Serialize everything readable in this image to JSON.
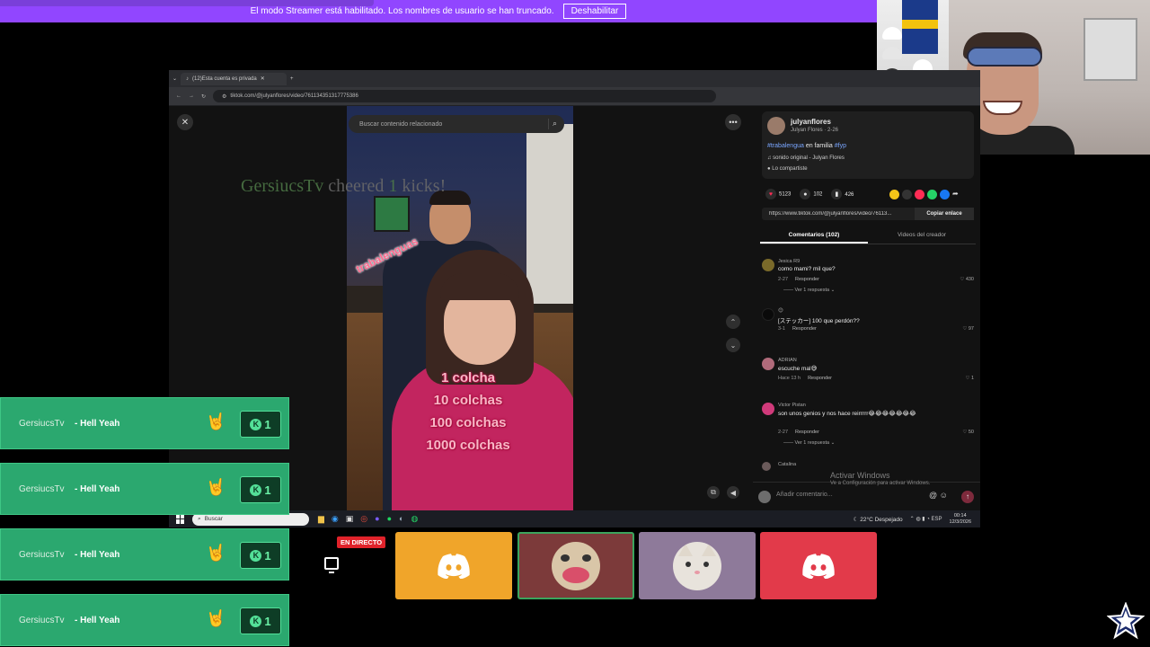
{
  "streamer_banner": {
    "message": "El modo Streamer está habilitado. Los nombres de usuario se han truncado.",
    "button_label": "Deshabilitar"
  },
  "browser": {
    "tab_title": "(12)Esta cuenta es privada",
    "url": "tiktok.com/@julyanflores/video/761134351317775386"
  },
  "video": {
    "search_placeholder": "Buscar contenido relacionado",
    "cheer": {
      "user": "GersiucsTv",
      "mid": "cheered",
      "count": "1",
      "end": "kicks!"
    },
    "tag": "trabalenguas",
    "overlay_lines": [
      "1 colcha",
      "10 colchas",
      "100 colchas",
      "1000 colchas"
    ]
  },
  "panel": {
    "author_name": "julyanflores",
    "author_sub": "Julyan Flores · 2-26",
    "caption_hash1": "#trabalengua",
    "caption_mid": " en familia ",
    "caption_hash2": "#fyp",
    "music": "sonido original - Julyan Flores",
    "shared": "Lo compartiste",
    "likes": "5123",
    "comments_count": "102",
    "saves": "426",
    "link": "https://www.tiktok.com/@julyanflores/video/76113...",
    "copy_label": "Copiar enlace",
    "tab_comments": "Comentarios (102)",
    "tab_creator": "Videos del creador",
    "comments": [
      {
        "user": "Jesica R9",
        "text": "como mami? mil que?",
        "date": "2-27",
        "reply": "Responder",
        "likes": "430",
        "replies": "—— Ver 1 respuesta ⌄",
        "color": "#7a6a2a"
      },
      {
        "user": "😊",
        "text": "[ステッカー] 100 que perdón??",
        "date": "3-1",
        "reply": "Responder",
        "likes": "97",
        "replies": "",
        "color": "#111111"
      },
      {
        "user": "ADRIAN",
        "text": "escuche mal😅",
        "date": "Hace 13 h",
        "reply": "Responder",
        "likes": "1",
        "replies": "",
        "color": "#b06a7a"
      },
      {
        "user": "Victor Pistan",
        "text": "son unos genios y nos hace reirrrrr😂😂😂😂😂😂😂",
        "date": "2-27",
        "reply": "Responder",
        "likes": "50",
        "replies": "—— Ver 1 respuesta ⌄",
        "color": "#d03a7a"
      },
      {
        "user": "Catalina",
        "text": "",
        "date": "",
        "reply": "",
        "likes": "",
        "replies": "",
        "color": "#6a5a5a"
      }
    ],
    "add_comment_placeholder": "Añadir comentario..."
  },
  "windows": {
    "activate_title": "Activar Windows",
    "activate_sub": "Ve a Configuración para activar Windows."
  },
  "taskbar": {
    "search": "Buscar",
    "weather": "22°C Despejado",
    "lang": "ESP",
    "time": "00:14",
    "date": "12/3/2026"
  },
  "alerts": [
    {
      "user": "GersiucsTv",
      "msg": "- Hell Yeah",
      "count": "1"
    },
    {
      "user": "GersiucsTv",
      "msg": "- Hell Yeah",
      "count": "1"
    },
    {
      "user": "GersiucsTv",
      "msg": "- Hell Yeah",
      "count": "1"
    },
    {
      "user": "GersiucsTv",
      "msg": "- Hell Yeah",
      "count": "1"
    }
  ],
  "call": {
    "live_label": "EN DIRECTO",
    "colors": {
      "tile_orange": "#f0a52a",
      "tile_maroon": "#7c3a3a",
      "tile_lavender": "#8e7a9a",
      "tile_red": "#e23a4a"
    }
  },
  "colors": {
    "banner": "#9146ff",
    "alert_green": "#2ba86f",
    "kick_green": "#53e098"
  }
}
